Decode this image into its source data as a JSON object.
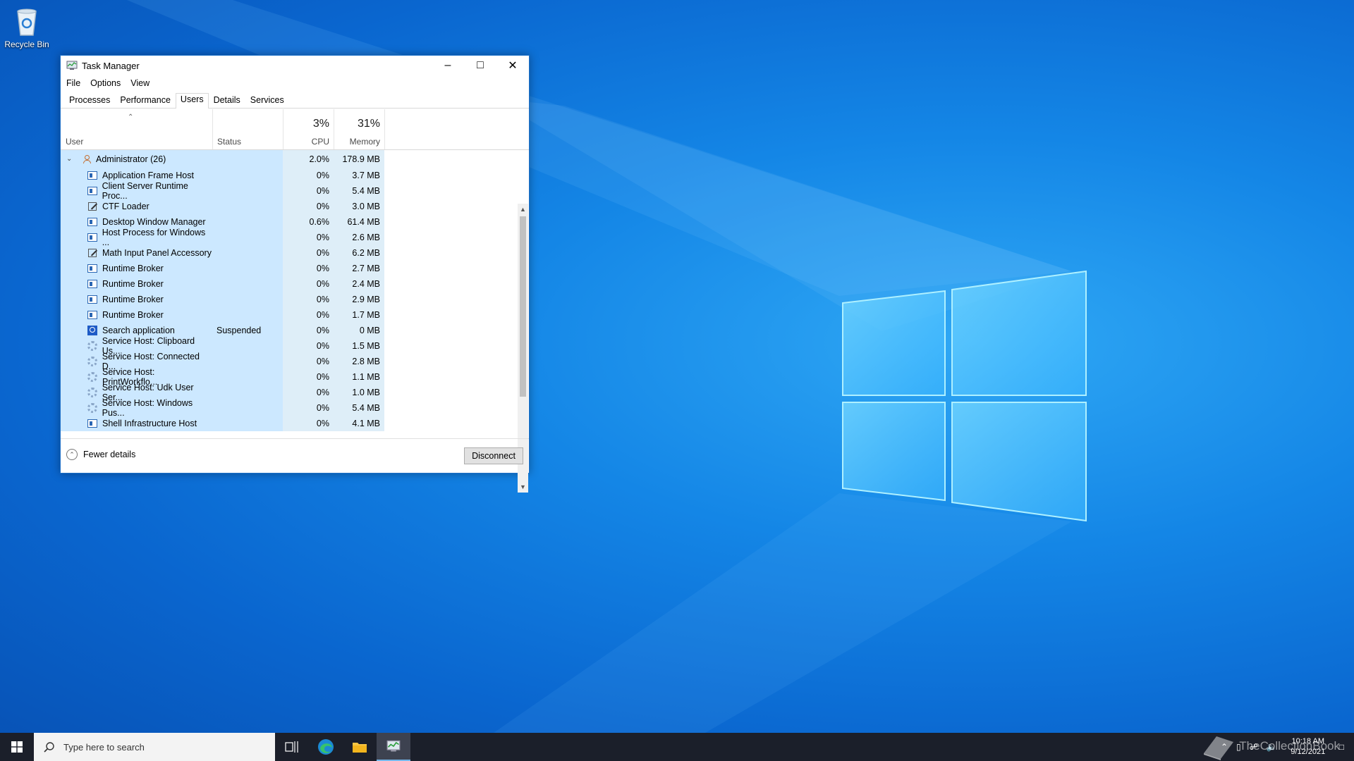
{
  "desktop": {
    "recycle_bin_label": "Recycle Bin"
  },
  "window": {
    "title": "Task Manager",
    "menu": [
      "File",
      "Options",
      "View"
    ],
    "tabs": [
      "Processes",
      "Performance",
      "Users",
      "Details",
      "Services"
    ],
    "active_tab": "Users",
    "columns": {
      "user": "User",
      "status": "Status",
      "cpu_pct": "3%",
      "cpu": "CPU",
      "mem_pct": "31%",
      "memory": "Memory"
    },
    "group": {
      "name": "Administrator (26)",
      "cpu": "2.0%",
      "memory": "178.9 MB"
    },
    "processes": [
      {
        "name": "Application Frame Host",
        "status": "",
        "cpu": "0%",
        "memory": "3.7 MB",
        "icon": "app-icon"
      },
      {
        "name": "Client Server Runtime Proc...",
        "status": "",
        "cpu": "0%",
        "memory": "5.4 MB",
        "icon": "app-icon"
      },
      {
        "name": "CTF Loader",
        "status": "",
        "cpu": "0%",
        "memory": "3.0 MB",
        "icon": "pen-icon"
      },
      {
        "name": "Desktop Window Manager",
        "status": "",
        "cpu": "0.6%",
        "memory": "61.4 MB",
        "icon": "app-icon"
      },
      {
        "name": "Host Process for Windows ...",
        "status": "",
        "cpu": "0%",
        "memory": "2.6 MB",
        "icon": "app-icon"
      },
      {
        "name": "Math Input Panel Accessory",
        "status": "",
        "cpu": "0%",
        "memory": "6.2 MB",
        "icon": "pen-icon"
      },
      {
        "name": "Runtime Broker",
        "status": "",
        "cpu": "0%",
        "memory": "2.7 MB",
        "icon": "app-icon"
      },
      {
        "name": "Runtime Broker",
        "status": "",
        "cpu": "0%",
        "memory": "2.4 MB",
        "icon": "app-icon"
      },
      {
        "name": "Runtime Broker",
        "status": "",
        "cpu": "0%",
        "memory": "2.9 MB",
        "icon": "app-icon"
      },
      {
        "name": "Runtime Broker",
        "status": "",
        "cpu": "0%",
        "memory": "1.7 MB",
        "icon": "app-icon"
      },
      {
        "name": "Search application",
        "status": "Suspended",
        "cpu": "0%",
        "memory": "0 MB",
        "icon": "search-icon"
      },
      {
        "name": "Service Host: Clipboard Us...",
        "status": "",
        "cpu": "0%",
        "memory": "1.5 MB",
        "icon": "gear-icon"
      },
      {
        "name": "Service Host: Connected D...",
        "status": "",
        "cpu": "0%",
        "memory": "2.8 MB",
        "icon": "gear-icon"
      },
      {
        "name": "Service Host: PrintWorkflo...",
        "status": "",
        "cpu": "0%",
        "memory": "1.1 MB",
        "icon": "gear-icon"
      },
      {
        "name": "Service Host: Udk User Ser...",
        "status": "",
        "cpu": "0%",
        "memory": "1.0 MB",
        "icon": "gear-icon"
      },
      {
        "name": "Service Host: Windows Pus...",
        "status": "",
        "cpu": "0%",
        "memory": "5.4 MB",
        "icon": "gear-icon"
      },
      {
        "name": "Shell Infrastructure Host",
        "status": "",
        "cpu": "0%",
        "memory": "4.1 MB",
        "icon": "app-icon"
      }
    ],
    "footer": {
      "fewer_details": "Fewer details",
      "disconnect": "Disconnect"
    }
  },
  "taskbar": {
    "search_placeholder": "Type here to search",
    "time": "10:18 AM",
    "date": "9/12/2021"
  },
  "watermark": "TheCollectionBook",
  "colors": {
    "accent": "#0078d7",
    "selection": "#cce8ff",
    "taskbar": "#1b1f2a"
  }
}
